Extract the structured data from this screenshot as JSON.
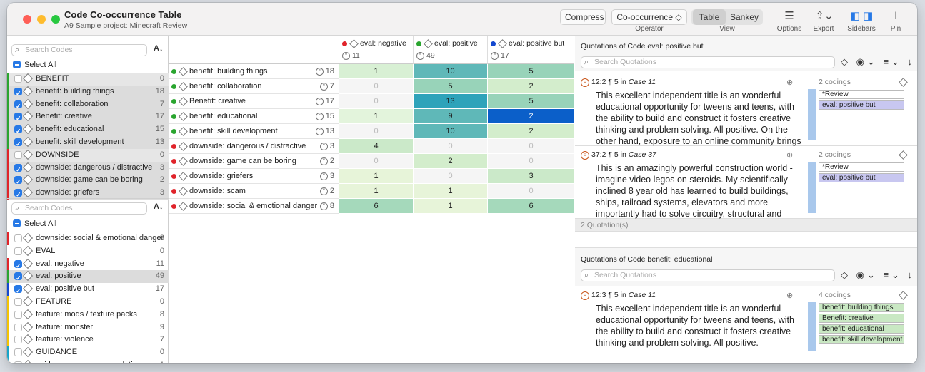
{
  "colors": {
    "red": "#e0242b",
    "green": "#2aa52f",
    "blue": "#1448d0",
    "yellow": "#f4c400",
    "cyan": "#17a5c9"
  },
  "window": {
    "title": "Code Co-occurrence Table",
    "subtitle": "A9 Sample project: Minecraft Review"
  },
  "toolbar": {
    "compress": "Compress",
    "operator_value": "Co-occurrence ◇",
    "operator_label": "Operator",
    "view_table": "Table",
    "view_sankey": "Sankey",
    "view_label": "View",
    "options": "Options",
    "export": "Export",
    "sidebars": "Sidebars",
    "pin": "Pin"
  },
  "left_top": {
    "search_placeholder": "Search Codes",
    "select_all": "Select All",
    "rows": [
      {
        "name": "BENEFIT",
        "count": "0",
        "checked": false,
        "color": "green"
      },
      {
        "name": "benefit: building things",
        "count": "18",
        "checked": true,
        "color": "green"
      },
      {
        "name": "benefit: collaboration",
        "count": "7",
        "checked": true,
        "color": "green"
      },
      {
        "name": "Benefit: creative",
        "count": "17",
        "checked": true,
        "color": "green"
      },
      {
        "name": "benefit: educational",
        "count": "15",
        "checked": true,
        "color": "green"
      },
      {
        "name": "benefit: skill development",
        "count": "13",
        "checked": true,
        "color": "green"
      },
      {
        "name": "DOWNSIDE",
        "count": "0",
        "checked": false,
        "color": "red"
      },
      {
        "name": "downside: dangerous / distractive",
        "count": "3",
        "checked": true,
        "color": "red"
      },
      {
        "name": "downside: game can be boring",
        "count": "2",
        "checked": true,
        "color": "red"
      },
      {
        "name": "downside: griefers",
        "count": "3",
        "checked": true,
        "color": "red"
      }
    ]
  },
  "left_bottom": {
    "search_placeholder": "Search Codes",
    "select_all": "Select All",
    "rows": [
      {
        "name": "downside: social & emotional danger",
        "count": "8",
        "checked": false,
        "color": "red",
        "sel": false
      },
      {
        "name": "EVAL",
        "count": "0",
        "checked": false,
        "color": "",
        "sel": false
      },
      {
        "name": "eval: negative",
        "count": "11",
        "checked": true,
        "color": "red",
        "sel": false
      },
      {
        "name": "eval: positive",
        "count": "49",
        "checked": true,
        "color": "green",
        "sel": true
      },
      {
        "name": "eval: positive but",
        "count": "17",
        "checked": true,
        "color": "blue",
        "sel": false
      },
      {
        "name": "FEATURE",
        "count": "0",
        "checked": false,
        "color": "yellow",
        "sel": false
      },
      {
        "name": "feature: mods / texture packs",
        "count": "8",
        "checked": false,
        "color": "yellow",
        "sel": false
      },
      {
        "name": "feature: monster",
        "count": "9",
        "checked": false,
        "color": "yellow",
        "sel": false
      },
      {
        "name": "feature: violence",
        "count": "7",
        "checked": false,
        "color": "yellow",
        "sel": false
      },
      {
        "name": "GUIDANCE",
        "count": "0",
        "checked": false,
        "color": "cyan",
        "sel": false
      },
      {
        "name": "guidance: no recommendation",
        "count": "1",
        "checked": false,
        "color": "cyan",
        "sel": false
      }
    ]
  },
  "table": {
    "columns": [
      {
        "name": "eval: negative",
        "count": "11",
        "color": "red"
      },
      {
        "name": "eval: positive",
        "count": "49",
        "color": "green"
      },
      {
        "name": "eval: positive but",
        "count": "17",
        "color": "blue"
      }
    ],
    "rows": [
      {
        "name": "benefit: building things",
        "count": "18",
        "color": "green",
        "values": [
          "1",
          "10",
          "5"
        ],
        "shades": [
          "#d8f0d4",
          "#5fb8b8",
          "#98d3b9"
        ]
      },
      {
        "name": "benefit: collaboration",
        "count": "7",
        "color": "green",
        "values": [
          "0",
          "5",
          "2"
        ],
        "shades": [
          "#f5f5f5",
          "#98d3b9",
          "#d3edcc"
        ]
      },
      {
        "name": "Benefit: creative",
        "count": "17",
        "color": "green",
        "values": [
          "0",
          "13",
          "5"
        ],
        "shades": [
          "#f5f5f5",
          "#2ea3ba",
          "#98d3b9"
        ]
      },
      {
        "name": "benefit: educational",
        "count": "15",
        "color": "green",
        "values": [
          "1",
          "9",
          "2"
        ],
        "shades": [
          "#e3f4dc",
          "#5fb8b8",
          "#0b5fc9"
        ]
      },
      {
        "name": "benefit: skill development",
        "count": "13",
        "color": "green",
        "values": [
          "0",
          "10",
          "2"
        ],
        "shades": [
          "#f5f5f5",
          "#5fb8b8",
          "#d3edcc"
        ]
      },
      {
        "name": "downside: dangerous / distractive",
        "count": "3",
        "color": "red",
        "values": [
          "4",
          "0",
          "0"
        ],
        "shades": [
          "#cbe9c9",
          "#f5f5f5",
          "#f5f5f5"
        ]
      },
      {
        "name": "downside: game can be boring",
        "count": "2",
        "color": "red",
        "values": [
          "0",
          "2",
          "0"
        ],
        "shades": [
          "#f5f5f5",
          "#d3edcc",
          "#f5f5f5"
        ]
      },
      {
        "name": "downside: griefers",
        "count": "3",
        "color": "red",
        "values": [
          "1",
          "0",
          "3"
        ],
        "shades": [
          "#e7f4d9",
          "#f5f5f5",
          "#cbe9c9"
        ]
      },
      {
        "name": "downside: scam",
        "count": "2",
        "color": "red",
        "values": [
          "1",
          "1",
          "0"
        ],
        "shades": [
          "#e7f4d9",
          "#e7f4d9",
          "#f5f5f5"
        ]
      },
      {
        "name": "downside: social & emotional danger",
        "count": "8",
        "color": "red",
        "values": [
          "6",
          "1",
          "6"
        ],
        "shades": [
          "#a5d9bb",
          "#e7f4d9",
          "#a5d9bb"
        ]
      }
    ]
  },
  "panel1": {
    "title": "Quotations of Code eval: positive but",
    "search_placeholder": "Search Quotations",
    "footer": "2 Quotation(s)",
    "quotes": [
      {
        "id": "12:2",
        "para": "¶ 5 in",
        "doc": "Case 11",
        "text": "This excellent independent title is an wonderful educational opportunity for tweens and teens, with the ability to build and construct it fosters creative thinking and problem solving. All positive. On the other hand, exposure to an online community brings privac…",
        "codings": "2 codings",
        "tags": [
          {
            "label": "*Review",
            "color": "#ffffff"
          },
          {
            "label": "eval: positive but",
            "color": "#c8c7f0"
          }
        ]
      },
      {
        "id": "37:2",
        "para": "¶ 5 in",
        "doc": "Case 37",
        "text": "This is an amazingly powerful construction world - imagine video legos on steroids. My scientifically inclined 8 year old has learned to build buildings, ships, railroad systems, elevators and more importantly had to solve circuitry, structural and mec…",
        "codings": "2 codings",
        "tags": [
          {
            "label": "*Review",
            "color": "#ffffff"
          },
          {
            "label": "eval: positive but",
            "color": "#c8c7f0"
          }
        ]
      }
    ]
  },
  "panel2": {
    "title": "Quotations of Code benefit: educational",
    "search_placeholder": "Search Quotations",
    "quotes": [
      {
        "id": "12:3",
        "para": "¶ 5 in",
        "doc": "Case 11",
        "text": "This excellent independent title is an wonderful educational opportunity for tweens and teens, with the ability to build and construct it fosters creative thinking and problem solving. All positive.",
        "codings": "4 codings",
        "tags": [
          {
            "label": "benefit: building things",
            "color": "#c9e8c3"
          },
          {
            "label": "Benefit: creative",
            "color": "#c9e8c3"
          },
          {
            "label": "benefit: educational",
            "color": "#c9e8c3"
          },
          {
            "label": "benefit: skill development",
            "color": "#c9e8c3"
          }
        ]
      }
    ]
  }
}
